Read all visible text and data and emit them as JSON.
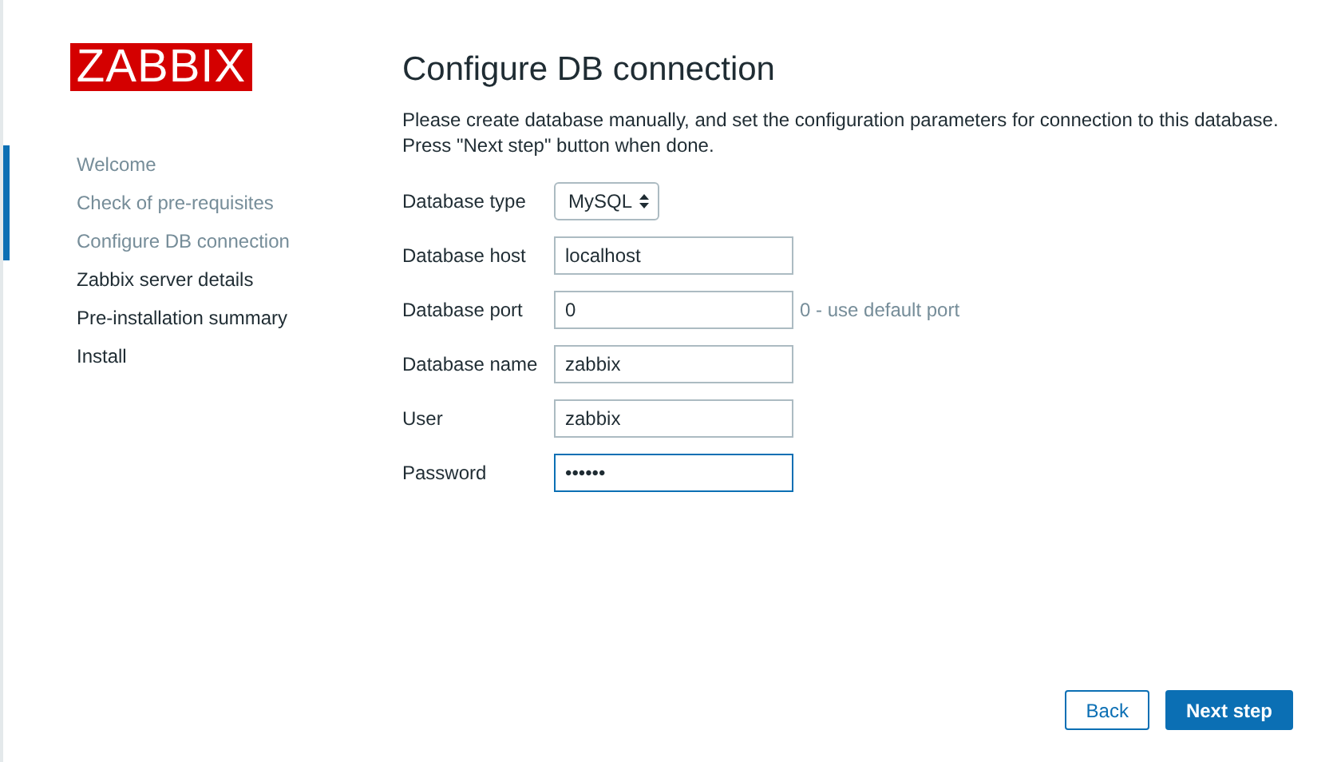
{
  "logo": "ZABBIX",
  "steps": [
    {
      "label": "Welcome",
      "done": true
    },
    {
      "label": "Check of pre-requisites",
      "done": true
    },
    {
      "label": "Configure DB connection",
      "done": true
    },
    {
      "label": "Zabbix server details",
      "done": false
    },
    {
      "label": "Pre-installation summary",
      "done": false
    },
    {
      "label": "Install",
      "done": false
    }
  ],
  "title": "Configure DB connection",
  "description": [
    "Please create database manually, and set the configuration parameters for connection to this database.",
    "Press \"Next step\" button when done."
  ],
  "fields": [
    {
      "kind": "select",
      "label": "Database type",
      "value": "MySQL"
    },
    {
      "kind": "text",
      "label": "Database host",
      "value": "localhost",
      "focused": false
    },
    {
      "kind": "text",
      "label": "Database port",
      "value": "0",
      "hint": "0 - use default port",
      "focused": false
    },
    {
      "kind": "text",
      "label": "Database name",
      "value": "zabbix",
      "focused": false
    },
    {
      "kind": "text",
      "label": "User",
      "value": "zabbix",
      "focused": false
    },
    {
      "kind": "text",
      "label": "Password",
      "value": "••••••",
      "focused": true
    }
  ],
  "buttons": [
    {
      "label": "Back",
      "primary": false
    },
    {
      "label": "Next step",
      "primary": true
    }
  ]
}
